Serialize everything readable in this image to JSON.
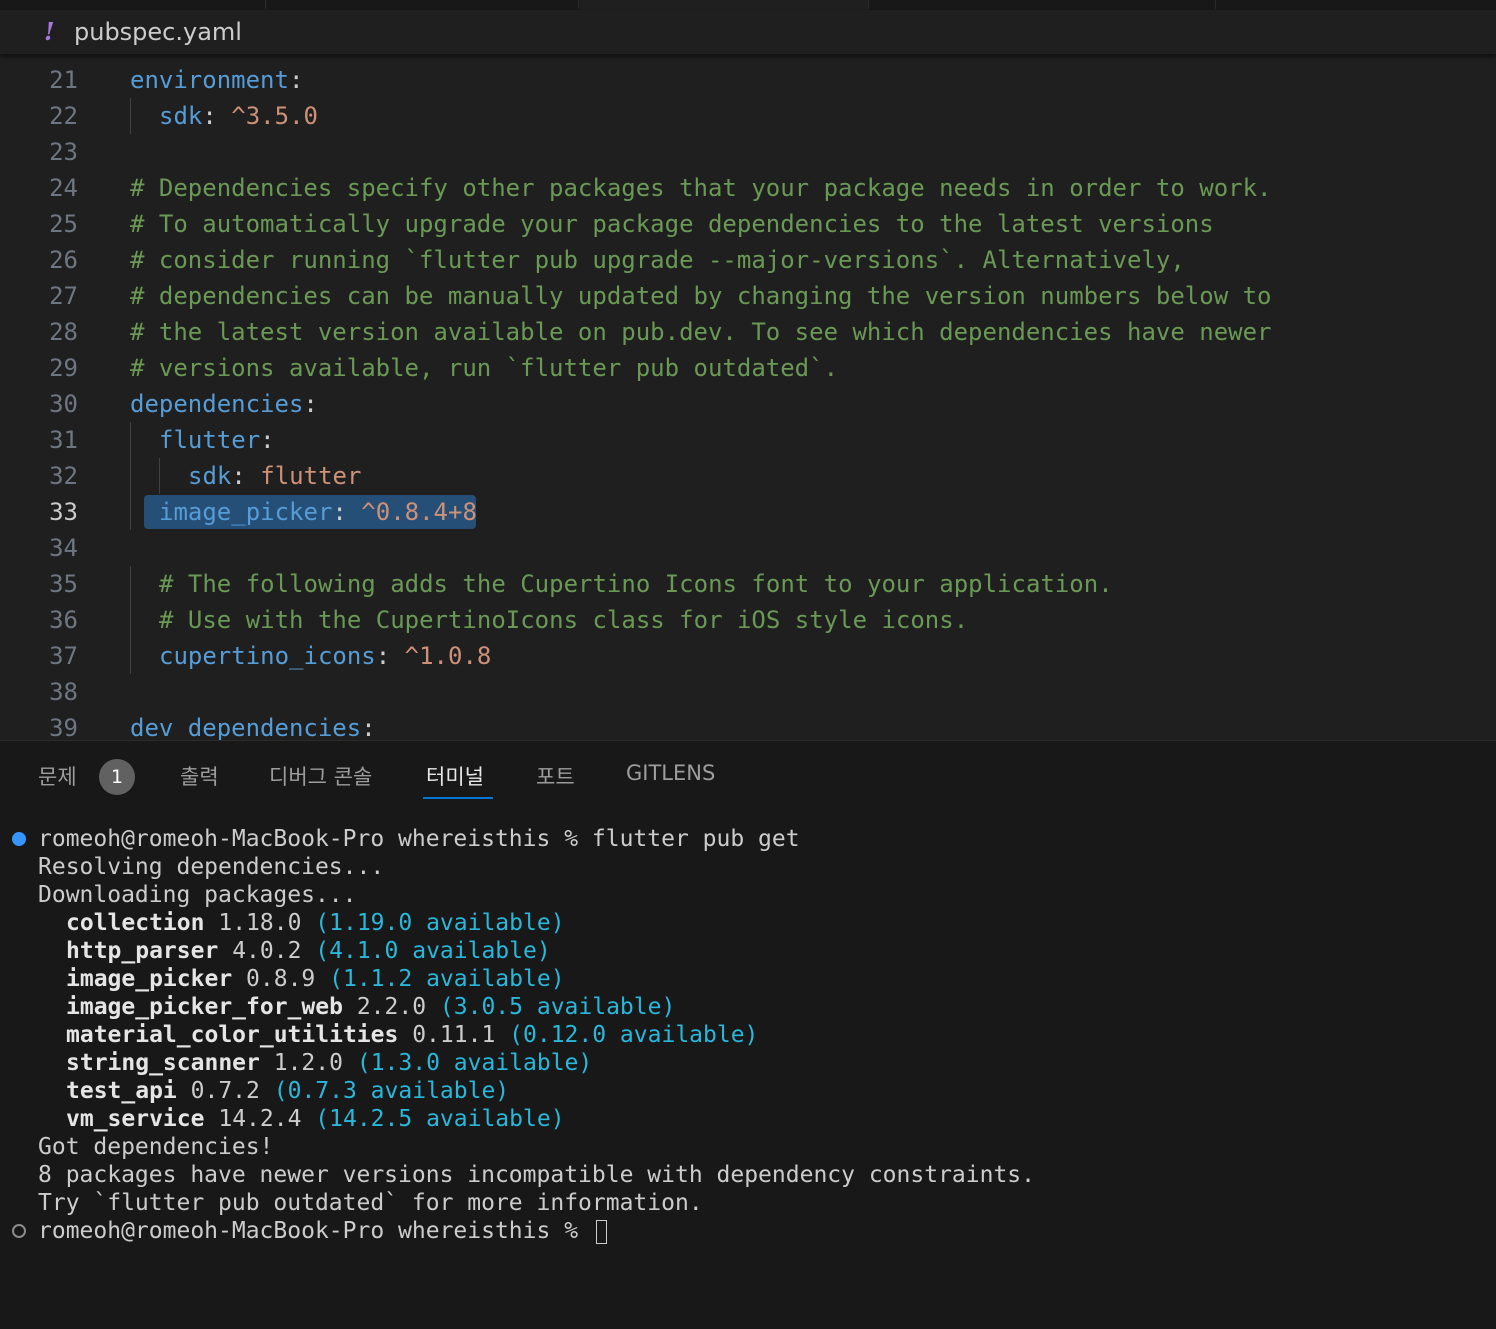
{
  "breadcrumb": {
    "icon": "!",
    "file": "pubspec.yaml"
  },
  "editor": {
    "current_line": 33,
    "lines": [
      {
        "n": "21",
        "indent": 0,
        "key": "environment",
        "punc": ":",
        "val": "",
        "comment": ""
      },
      {
        "n": "22",
        "indent": 1,
        "key": "sdk",
        "punc": ": ",
        "val": "^3.5.0",
        "comment": ""
      },
      {
        "n": "23",
        "indent": 0,
        "key": "",
        "punc": "",
        "val": "",
        "comment": ""
      },
      {
        "n": "24",
        "indent": 0,
        "key": "",
        "punc": "",
        "val": "",
        "comment": "# Dependencies specify other packages that your package needs in order to work."
      },
      {
        "n": "25",
        "indent": 0,
        "key": "",
        "punc": "",
        "val": "",
        "comment": "# To automatically upgrade your package dependencies to the latest versions"
      },
      {
        "n": "26",
        "indent": 0,
        "key": "",
        "punc": "",
        "val": "",
        "comment": "# consider running `flutter pub upgrade --major-versions`. Alternatively,"
      },
      {
        "n": "27",
        "indent": 0,
        "key": "",
        "punc": "",
        "val": "",
        "comment": "# dependencies can be manually updated by changing the version numbers below to"
      },
      {
        "n": "28",
        "indent": 0,
        "key": "",
        "punc": "",
        "val": "",
        "comment": "# the latest version available on pub.dev. To see which dependencies have newer"
      },
      {
        "n": "29",
        "indent": 0,
        "key": "",
        "punc": "",
        "val": "",
        "comment": "# versions available, run `flutter pub outdated`."
      },
      {
        "n": "30",
        "indent": 0,
        "key": "dependencies",
        "punc": ":",
        "val": "",
        "comment": ""
      },
      {
        "n": "31",
        "indent": 1,
        "key": "flutter",
        "punc": ":",
        "val": "",
        "comment": ""
      },
      {
        "n": "32",
        "indent": 2,
        "key": "sdk",
        "punc": ": ",
        "val": "flutter",
        "comment": ""
      },
      {
        "n": "33",
        "indent": 1,
        "key": "image_picker",
        "punc": ": ",
        "val": "^0.8.4+8",
        "comment": "",
        "selected": true
      },
      {
        "n": "34",
        "indent": 0,
        "key": "",
        "punc": "",
        "val": "",
        "comment": ""
      },
      {
        "n": "35",
        "indent": 1,
        "key": "",
        "punc": "",
        "val": "",
        "comment": "# The following adds the Cupertino Icons font to your application."
      },
      {
        "n": "36",
        "indent": 1,
        "key": "",
        "punc": "",
        "val": "",
        "comment": "# Use with the CupertinoIcons class for iOS style icons."
      },
      {
        "n": "37",
        "indent": 1,
        "key": "cupertino_icons",
        "punc": ": ",
        "val": "^1.0.8",
        "comment": ""
      },
      {
        "n": "38",
        "indent": 0,
        "key": "",
        "punc": "",
        "val": "",
        "comment": ""
      },
      {
        "n": "39",
        "indent": 0,
        "key": "dev_dependencies",
        "punc": ":",
        "val": "",
        "comment": ""
      }
    ]
  },
  "panel": {
    "tabs": [
      {
        "label": "문제",
        "active": false
      },
      {
        "label": "출력",
        "active": false
      },
      {
        "label": "디버그 콘솔",
        "active": false
      },
      {
        "label": "터미널",
        "active": true
      },
      {
        "label": "포트",
        "active": false
      },
      {
        "label": "GITLENS",
        "active": false
      }
    ],
    "problems_count": "1"
  },
  "terminal": {
    "prompt1": "romeoh@romeoh-MacBook-Pro whereisthis % flutter pub get",
    "resolving": "Resolving dependencies...",
    "downloading": "Downloading packages...",
    "packages": [
      {
        "name": "collection",
        "current": "1.18.0",
        "available": "(1.19.0 available)"
      },
      {
        "name": "http_parser",
        "current": "4.0.2",
        "available": "(4.1.0 available)"
      },
      {
        "name": "image_picker",
        "current": "0.8.9",
        "available": "(1.1.2 available)"
      },
      {
        "name": "image_picker_for_web",
        "current": "2.2.0",
        "available": "(3.0.5 available)"
      },
      {
        "name": "material_color_utilities",
        "current": "0.11.1",
        "available": "(0.12.0 available)"
      },
      {
        "name": "string_scanner",
        "current": "1.2.0",
        "available": "(1.3.0 available)"
      },
      {
        "name": "test_api",
        "current": "0.7.2",
        "available": "(0.7.3 available)"
      },
      {
        "name": "vm_service",
        "current": "14.2.4",
        "available": "(14.2.5 available)"
      }
    ],
    "got": "Got dependencies!",
    "newer": "8 packages have newer versions incompatible with dependency constraints.",
    "try": "Try `flutter pub outdated` for more information.",
    "prompt2": "romeoh@romeoh-MacBook-Pro whereisthis % "
  },
  "colors": {
    "accent": "#0078d4",
    "key": "#569cd6",
    "value": "#ce9178",
    "comment": "#6a9955",
    "available": "#29b8db",
    "selection": "#264f78"
  }
}
